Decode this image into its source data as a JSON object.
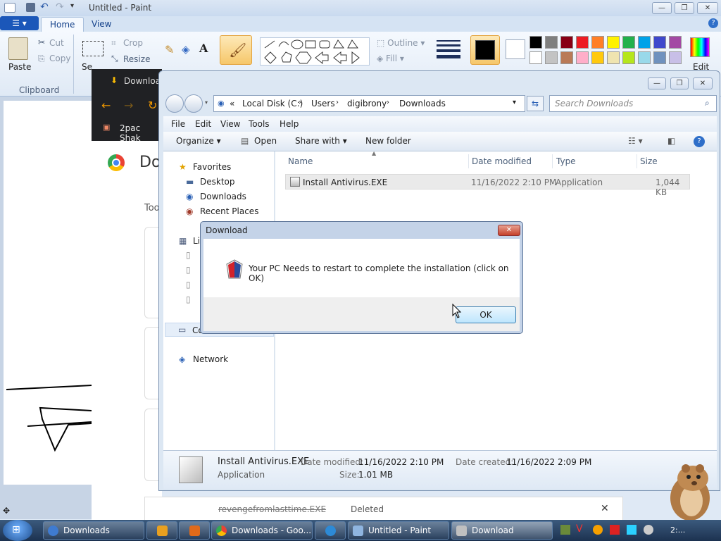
{
  "paint": {
    "title": "Untitled - Paint",
    "tabs": {
      "home": "Home",
      "view": "View"
    },
    "clipboard": {
      "paste": "Paste",
      "cut": "Cut",
      "copy": "Copy",
      "group": "Clipboard",
      "select_partial": "Se"
    },
    "image": {
      "crop": "Crop",
      "resize": "Resize"
    },
    "shapes": {
      "outline": "Outline",
      "fill": "Fill"
    },
    "edit_colors": "Edit",
    "palette_row1": [
      "#000000",
      "#7f7f7f",
      "#880015",
      "#ed1c24",
      "#ff7f27",
      "#fff200",
      "#22b14c",
      "#00a2e8",
      "#3f48cc",
      "#a349a4"
    ],
    "palette_row2": [
      "#ffffff",
      "#c3c3c3",
      "#b97a57",
      "#ffaec9",
      "#ffc90e",
      "#efe4b0",
      "#b5e61d",
      "#99d9ea",
      "#7092be",
      "#c8bfe7"
    ]
  },
  "chrome": {
    "tab_partial": "Downloa",
    "bookmark_partial": "2pac Shak",
    "heading_partial": "Do",
    "text_partial": "Too"
  },
  "explorer": {
    "breadcrumb": [
      "Local Disk (C:)",
      "Users",
      "digibrony",
      "Downloads"
    ],
    "search_placeholder": "Search Downloads",
    "menu": [
      "File",
      "Edit",
      "View",
      "Tools",
      "Help"
    ],
    "toolbar": {
      "organize": "Organize",
      "open": "Open",
      "share": "Share with",
      "new_folder": "New folder"
    },
    "nav": {
      "favorites": "Favorites",
      "desktop": "Desktop",
      "downloads": "Downloads",
      "recent": "Recent Places",
      "libraries_partial": "Lib",
      "computer_partial": "Co",
      "network": "Network"
    },
    "columns": [
      "Name",
      "Date modified",
      "Type",
      "Size"
    ],
    "files": [
      {
        "name": "Install Antivirus.EXE",
        "date": "11/16/2022 2:10 PM",
        "type": "Application",
        "size": "1,044 KB"
      }
    ],
    "details": {
      "name": "Install Antivirus.EXE",
      "type": "Application",
      "modified_label": "Date modified:",
      "modified": "11/16/2022 2:10 PM",
      "size_label": "Size:",
      "size": "1.01 MB",
      "created_label": "Date created:",
      "created": "11/16/2022 2:09 PM"
    }
  },
  "dialog": {
    "title": "Download",
    "message": "Your PC Needs to restart to complete the installation (click on OK)",
    "ok": "OK"
  },
  "notification": {
    "file": "revengefromlasttime.EXE",
    "status": "Deleted"
  },
  "taskbar": {
    "items": [
      "Downloads",
      "Downloads - Goo...",
      "Untitled - Paint",
      "Download"
    ],
    "clock_partial": "2:..."
  }
}
